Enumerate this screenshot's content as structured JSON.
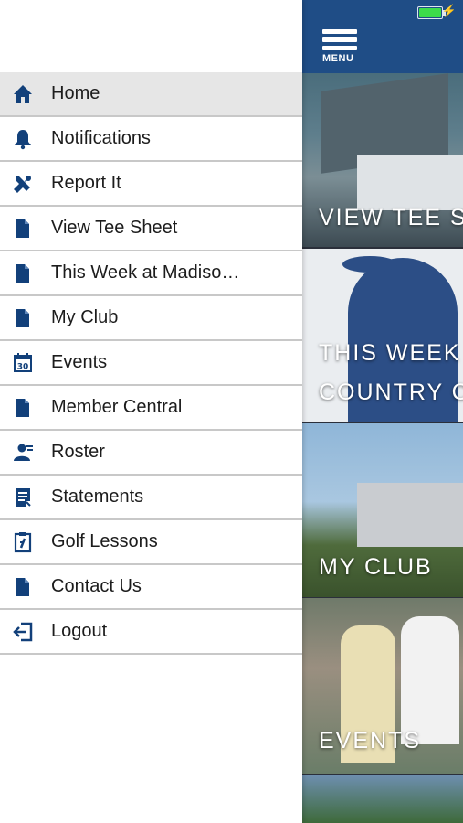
{
  "menu_label": "MENU",
  "colors": {
    "brand": "#1f4d86",
    "icon": "#12407a"
  },
  "drawer": {
    "items": [
      {
        "label": "Home",
        "icon": "home-icon"
      },
      {
        "label": "Notifications",
        "icon": "bell-icon"
      },
      {
        "label": "Report It",
        "icon": "tools-icon"
      },
      {
        "label": "View Tee Sheet",
        "icon": "document-icon"
      },
      {
        "label": "This Week at Madiso…",
        "icon": "document-icon"
      },
      {
        "label": "My Club",
        "icon": "document-icon"
      },
      {
        "label": "Events",
        "icon": "calendar-icon"
      },
      {
        "label": "Member Central",
        "icon": "document-icon"
      },
      {
        "label": "Roster",
        "icon": "person-icon"
      },
      {
        "label": "Statements",
        "icon": "statement-icon"
      },
      {
        "label": "Golf Lessons",
        "icon": "clipboard-icon"
      },
      {
        "label": "Contact Us",
        "icon": "document-icon"
      },
      {
        "label": "Logout",
        "icon": "logout-icon"
      }
    ],
    "calendar_day": "30"
  },
  "tiles": [
    {
      "caption": "VIEW TEE S"
    },
    {
      "caption_line1": "THIS WEEK",
      "caption_line2": "COUNTRY C"
    },
    {
      "caption": "MY CLUB"
    },
    {
      "caption": "EVENTS"
    }
  ]
}
